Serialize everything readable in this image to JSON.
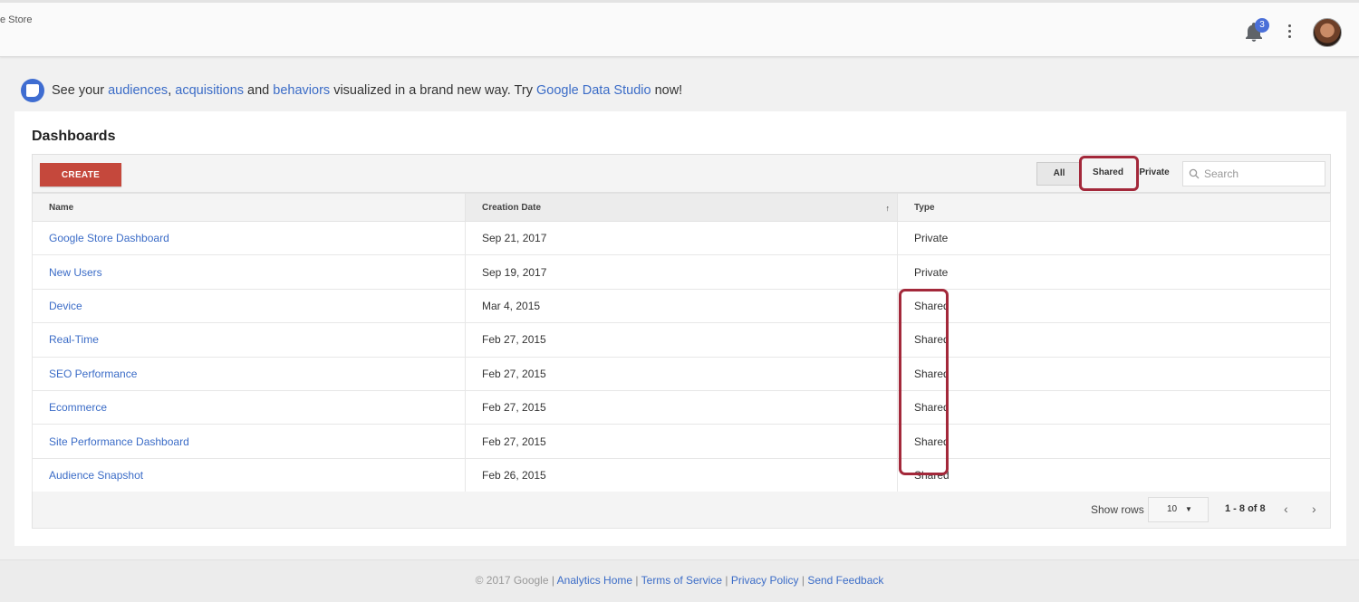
{
  "header": {
    "crumb": "e Store",
    "notification_count": "3"
  },
  "promo": {
    "prefix": "See your",
    "link_audiences": "audiences",
    "comma": ",",
    "link_acquisitions": "acquisitions",
    "and": "and",
    "link_behaviors": "behaviors",
    "middle": "visualized in a brand new way. Try",
    "link_studio": "Google Data Studio",
    "suffix": "now!"
  },
  "dashboards": {
    "title": "Dashboards",
    "create_label": "CREATE",
    "filters": {
      "all": "All",
      "shared": "Shared",
      "private": "Private"
    },
    "search_placeholder": "Search",
    "columns": {
      "name": "Name",
      "date": "Creation Date",
      "type": "Type"
    },
    "sort_indicator": "↑",
    "rows": [
      {
        "name": "Google Store Dashboard",
        "date": "Sep 21, 2017",
        "type": "Private"
      },
      {
        "name": "New Users",
        "date": "Sep 19, 2017",
        "type": "Private"
      },
      {
        "name": "Device",
        "date": "Mar 4, 2015",
        "type": "Shared"
      },
      {
        "name": "Real-Time",
        "date": "Feb 27, 2015",
        "type": "Shared"
      },
      {
        "name": "SEO Performance",
        "date": "Feb 27, 2015",
        "type": "Shared"
      },
      {
        "name": "Ecommerce",
        "date": "Feb 27, 2015",
        "type": "Shared"
      },
      {
        "name": "Site Performance Dashboard",
        "date": "Feb 27, 2015",
        "type": "Shared"
      },
      {
        "name": "Audience Snapshot",
        "date": "Feb 26, 2015",
        "type": "Shared"
      }
    ],
    "pager": {
      "show_rows_label": "Show rows",
      "rows_value": "10",
      "range": "1 - 8 of 8",
      "prev": "‹",
      "next": "›"
    }
  },
  "footer": {
    "copyright": "© 2017 Google",
    "links": [
      "Analytics Home",
      "Terms of Service",
      "Privacy Policy",
      "Send Feedback"
    ]
  },
  "colors": {
    "accent": "#3b6cc7",
    "create": "#c5483c",
    "highlight": "#a3283a",
    "badge": "#4a6fd8"
  }
}
